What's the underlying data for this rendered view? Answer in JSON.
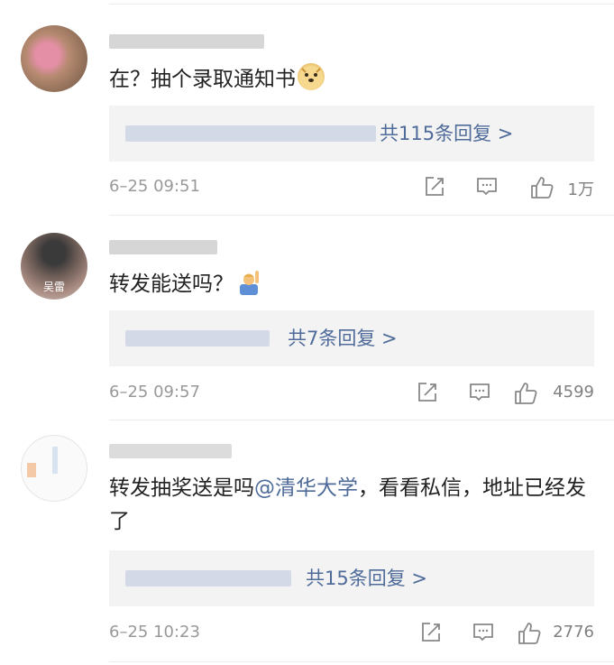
{
  "comments": [
    {
      "text": "在？抽个录取通知书",
      "emoji": "doge-emoji",
      "reply_summary": "共115条回复 >",
      "time": "6–25 09:51",
      "likes": "1万"
    },
    {
      "avatar_text": "吴雷",
      "text": "转发能送吗？",
      "emoji": "person-raising-hand-emoji",
      "reply_summary": "共7条回复 >",
      "time": "6–25 09:57",
      "likes": "4599"
    },
    {
      "text_before": "转发抽奖送是吗",
      "mention": "@清华大学",
      "text_after": "，看看私信，地址已经发了",
      "reply_summary": "共15条回复 >",
      "time": "6–25 10:23",
      "likes": "2776"
    }
  ],
  "icons": {
    "share": "share-icon",
    "comment": "comment-icon",
    "like": "thumbs-up-icon"
  },
  "colors": {
    "link": "#4f6b9a",
    "meta": "#999999",
    "reply_bg": "#f3f3f3"
  }
}
